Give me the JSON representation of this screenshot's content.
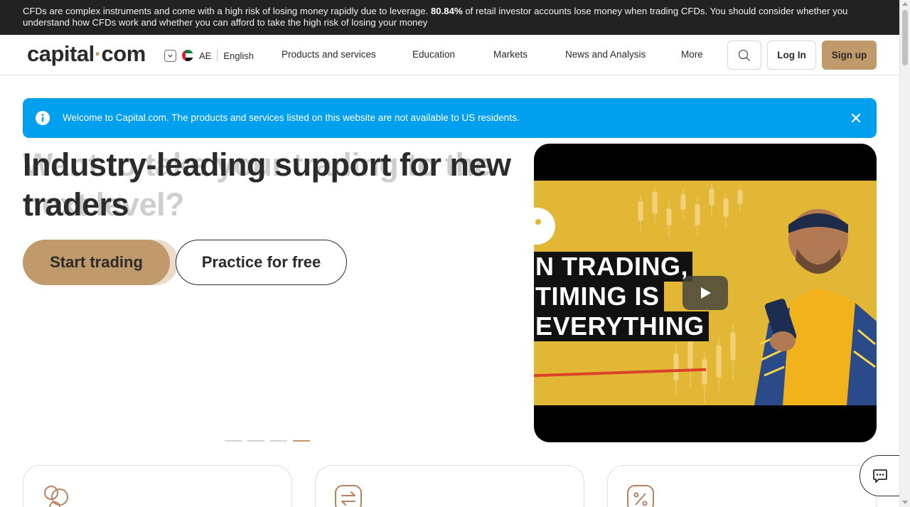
{
  "risk_warning": {
    "prefix": "CFDs are complex instruments and come with a high risk of losing money rapidly due to leverage.",
    "percent": "80.84%",
    "suffix": "of retail investor accounts lose money when trading CFDs. You should consider whether you understand how CFDs work and whether you can afford to take the high risk of losing your money"
  },
  "header": {
    "logo_main": "capital",
    "logo_dot": "·",
    "logo_tld": "com",
    "region_code": "AE",
    "language": "English",
    "nav": [
      "Products and services",
      "Education",
      "Markets",
      "News and Analysis",
      "More"
    ],
    "login": "Log In",
    "signup": "Sign up"
  },
  "notice": {
    "message": "Welcome to Capital.com. The products and services listed on this website are not available to US residents."
  },
  "hero": {
    "title": "Industry-leading support for new traders",
    "ghost_title": "Want to take your trading to the next level?",
    "primary_button": "Start trading",
    "secondary_button": "Practice for free",
    "slides_total": 4,
    "active_slide": 4
  },
  "video": {
    "lines": [
      "N TRADING,",
      "TIMING IS",
      "EVERYTHING"
    ]
  },
  "colors": {
    "brand": "#c19a6b",
    "notice_blue": "#00a0ee",
    "risk_bg": "#222222"
  }
}
